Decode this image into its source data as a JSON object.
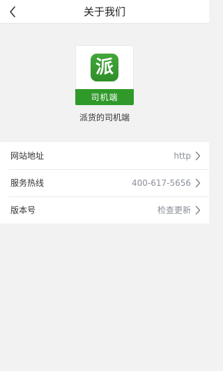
{
  "navbar": {
    "title": "关于我们",
    "back_icon": "chevron-left-icon"
  },
  "app": {
    "logo_glyph": "派",
    "logo_band_text": "司机端",
    "name": "派货的司机端",
    "brand_color": "#2f9a2a"
  },
  "settings": [
    {
      "label": "网站地址",
      "value": "http"
    },
    {
      "label": "服务热线",
      "value": "400-617-5656"
    },
    {
      "label": "版本号",
      "value": "检查更新"
    }
  ]
}
